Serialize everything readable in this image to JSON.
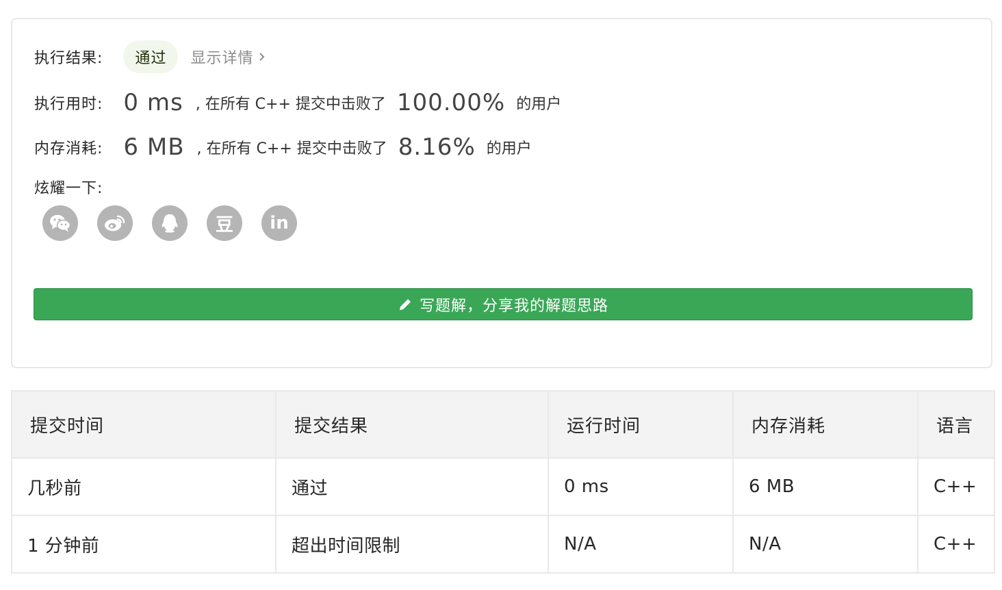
{
  "result": {
    "label": "执行结果:",
    "status": "通过",
    "detail_link": "显示详情"
  },
  "runtime": {
    "label": "执行用时:",
    "value": "0 ms",
    "mid": ", 在所有 C++ 提交中击败了",
    "percent": "100.00%",
    "tail": "的用户"
  },
  "memory": {
    "label": "内存消耗:",
    "value": "6 MB",
    "mid": ", 在所有 C++ 提交中击败了",
    "percent": "8.16%",
    "tail": "的用户"
  },
  "share": {
    "label": "炫耀一下:",
    "icons": [
      "wechat-icon",
      "weibo-icon",
      "qq-icon",
      "douban-icon",
      "linkedin-icon"
    ],
    "douban_glyph": "豆",
    "linkedin_glyph": "in"
  },
  "write_solution": {
    "label": "写题解，分享我的解题思路",
    "icon": "pencil-icon"
  },
  "submissions": {
    "headers": [
      "提交时间",
      "提交结果",
      "运行时间",
      "内存消耗",
      "语言"
    ],
    "rows": [
      [
        "几秒前",
        "通过",
        "0 ms",
        "6 MB",
        "C++"
      ],
      [
        "1 分钟前",
        "超出时间限制",
        "N/A",
        "N/A",
        "C++"
      ]
    ]
  },
  "colors": {
    "accept": "#4da534",
    "error": "#e53935",
    "button": "#3aa757",
    "icon_gray": "#b5b5b5",
    "badge_bg": "#f2f7ed"
  }
}
